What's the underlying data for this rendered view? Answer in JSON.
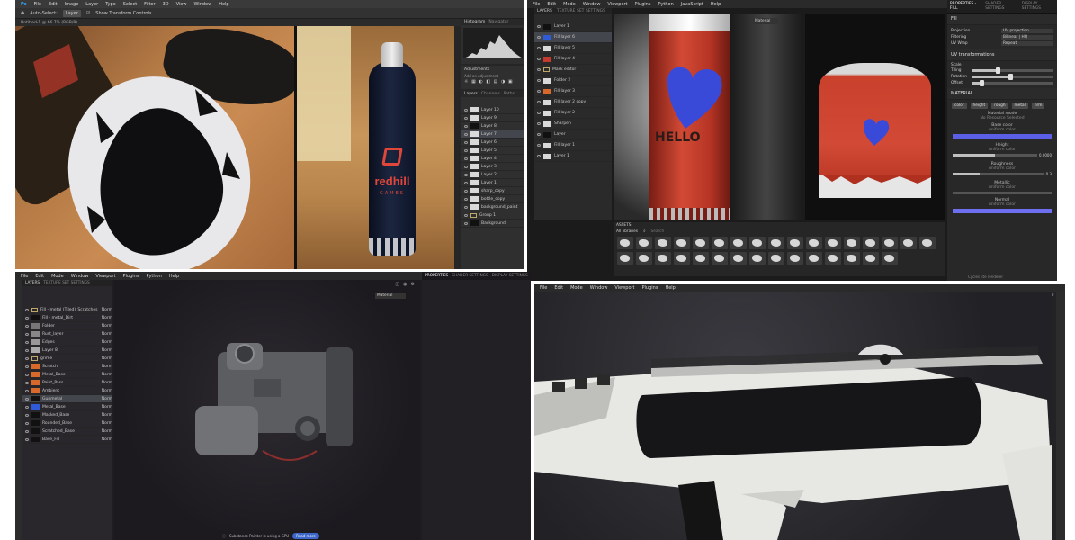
{
  "photoshop": {
    "menu": [
      "Ps",
      "File",
      "Edit",
      "Image",
      "Layer",
      "Type",
      "Select",
      "Filter",
      "3D",
      "View",
      "Window",
      "Help"
    ],
    "opt_auto_select": "Auto-Select:",
    "opt_layer": "Layer",
    "opt_transform": "Show Transform Controls",
    "doc_tab": "Untitled-1 @ 66.7% (RGB/8)",
    "histogram_tab": "Histogram",
    "navigator_tab": "Navigator",
    "adjustments": "Adjustments",
    "add_adjustment": "Add an adjustment",
    "layers_tab": "Layers",
    "channels_tab": "Channels",
    "paths_tab": "Paths",
    "bottle_brand": "redhill",
    "bottle_sub": "GAMES",
    "layers": [
      "Layer 10",
      "Layer 9",
      "Layer 8",
      "Layer 7",
      "Layer 6",
      "Layer 5",
      "Layer 4",
      "Layer 3",
      "Layer 2",
      "Layer 1",
      "sharp_copy",
      "bottle_copy",
      "background_paint",
      "Group 1",
      "Background"
    ]
  },
  "painter_top": {
    "menu": [
      "File",
      "Edit",
      "Mode",
      "Window",
      "Viewport",
      "Plugins",
      "Python",
      "JavaScript",
      "Help"
    ],
    "layers_tab": "LAYERS",
    "texture_tab": "TEXTURE SET SETTINGS",
    "properties_tab": "PROPERTIES - FILL",
    "shader_tab": "SHADER SETTINGS",
    "display_tab": "DISPLAY SETTINGS",
    "viewport_mode": "Material",
    "fill": "Fill",
    "projection_label": "Projection",
    "projection_val": "UV projection",
    "filtering_label": "Filtering",
    "filtering_val": "Bilinear | HQ",
    "uvwrap_label": "UV Wrap",
    "uvwrap_val": "Repeat",
    "uv_transform": "UV transformations",
    "scale_label": "Scale",
    "tiling_label": "Tiling",
    "rotation_label": "Rotation",
    "offset_label": "Offset",
    "material": "MATERIAL",
    "mat_btns": [
      "color",
      "height",
      "rough",
      "metal",
      "nrm"
    ],
    "material_mode": "Material mode",
    "no_resource": "No Resource Selected",
    "base_color": "Base color",
    "uniform": "uniform color",
    "height": "Height",
    "height_val": "0.0000",
    "roughness": "Roughness",
    "roughness_val": "0.3",
    "metallic": "Metallic",
    "normal": "Normal",
    "assets": "ASSETS",
    "all_libraries": "All libraries",
    "search": "Search",
    "layer_rows": [
      "Layer 1",
      "Fill layer 6",
      "Fill layer 5",
      "Fill layer 4",
      "Mask editor",
      "Folder 2",
      "Fill layer 3",
      "Fill layer 2 copy",
      "Fill layer 2",
      "Sharpen",
      "Layer",
      "Fill layer 1",
      "Layer 1"
    ],
    "bottle_text": "HELLO",
    "status": "Cycles lite renderer"
  },
  "painter_bottom": {
    "menu": [
      "File",
      "Edit",
      "Mode",
      "Window",
      "Viewport",
      "Plugins",
      "Python",
      "Help"
    ],
    "layers_tab": "LAYERS",
    "texture_tab": "TEXTURE SET SETTINGS",
    "properties_tab": "PROPERTIES",
    "shader_tab": "SHADER SETTINGS",
    "display_tab": "DISPLAY SETTINGS",
    "viewport_mode": "Material",
    "layer_rows": [
      "Fill - metal (Tiled)_Scratches",
      "Fill - metal_Dirt",
      "Folder",
      "Rust_layer",
      "Edges",
      "Layer 8",
      "grime",
      "Scratch",
      "Metal_Base",
      "Paint_Pass",
      "Ambient",
      "Gunmetal",
      "Metal_Base",
      "Masked_Base",
      "Rounded_Base",
      "Scratched_Base",
      "Base_Fill"
    ],
    "blend": "Norm",
    "notice": "Substance Painter is using a GPU",
    "notice_btn": "Read more"
  },
  "painter_rifle": {
    "menu": [
      "File",
      "Edit",
      "Mode",
      "Window",
      "Viewport",
      "Plugins",
      "Help"
    ],
    "viewport_mode": "Material"
  },
  "colors": {
    "ui_dark": "#262626",
    "accent_blue": "#5b5fe6",
    "bottle_red": "#c23b2c",
    "heart_blue": "#3a4ad8"
  }
}
